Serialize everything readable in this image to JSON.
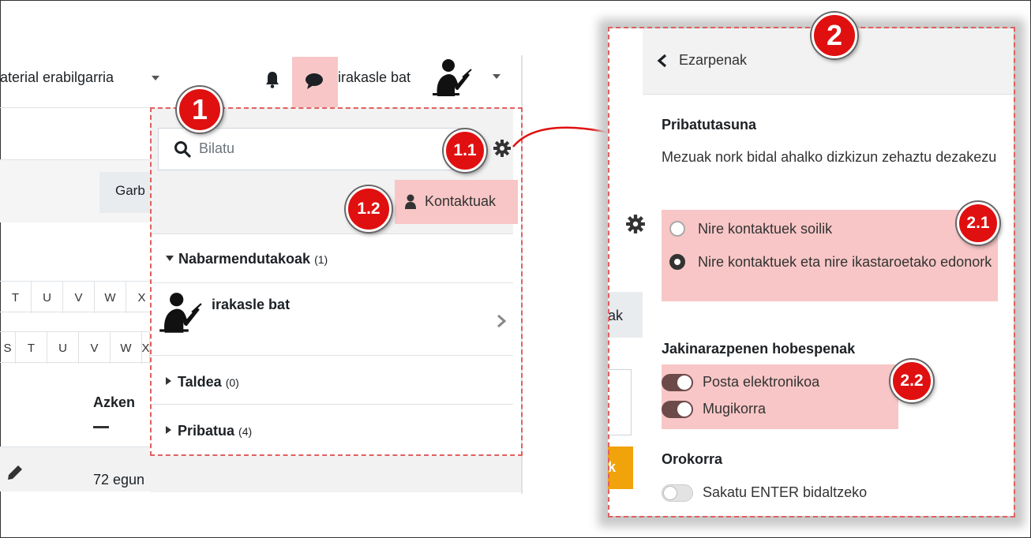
{
  "nav": {
    "menu_text": "aterial erabilgarria",
    "username": "irakasle bat"
  },
  "page": {
    "garb_button": "Garb",
    "letters_row1": [
      "T",
      "U",
      "V",
      "W",
      "X"
    ],
    "letters_row2": [
      "S",
      "T",
      "U",
      "V",
      "W",
      "X"
    ],
    "column_header": "Azken",
    "row_value": "72 egun"
  },
  "drawer": {
    "search_placeholder": "Bilatu",
    "contacts_label": "Kontaktuak",
    "sections": [
      {
        "label": "Nabarmendutakoak",
        "count": "(1)",
        "expanded": true
      },
      {
        "label": "Taldea",
        "count": "(0)",
        "expanded": false
      },
      {
        "label": "Pribatua",
        "count": "(4)",
        "expanded": false
      }
    ],
    "contact_name": "irakasle bat"
  },
  "settings": {
    "back_label": "Ezarpenak",
    "privacy_title": "Pribatutasuna",
    "privacy_text": "Mezuak nork bidal ahalko dizkizun zehaztu dezakezu",
    "option1": "Nire kontaktuek soilik",
    "option2": "Nire kontaktuek eta nire ikastaroetako edonork",
    "notif_title": "Jakinarazpenen hobespenak",
    "notif_email": "Posta elektronikoa",
    "notif_mobile": "Mugikorra",
    "general_title": "Orokorra",
    "enter_label": "Sakatu ENTER bidaltzeko",
    "stub_ak": "ak",
    "stub_k": "k"
  },
  "annotations": {
    "b1": "1",
    "b11": "1.1",
    "b12": "1.2",
    "b2": "2",
    "b21": "2.1",
    "b22": "2.2"
  },
  "colors": {
    "highlight": "#f8c6c6",
    "badge": "#e01010",
    "dash": "#e06060",
    "toggle_on": "#6d4a4a",
    "orange": "#f0a30a"
  }
}
